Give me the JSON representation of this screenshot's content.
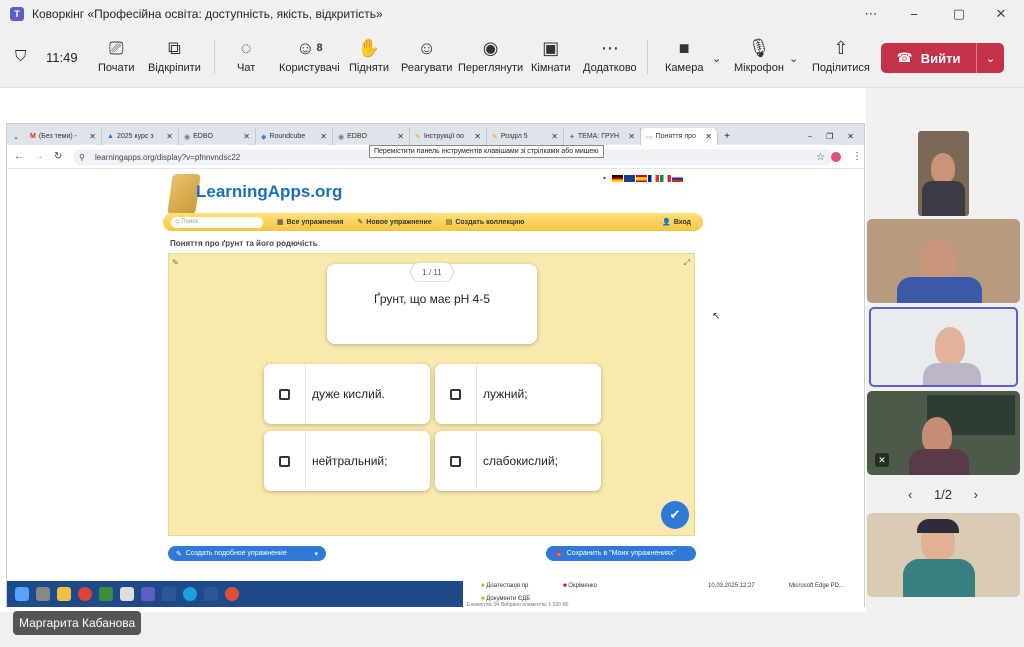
{
  "window": {
    "title": "Коворкінг «Професійна освіта: доступність, якість, відкритість»",
    "minimize": "⎯",
    "maximize": "▢",
    "close": "✕"
  },
  "toolbar": {
    "time": "11:49",
    "present": "Почати",
    "popout": "Відкріпити",
    "chat": "Чат",
    "people": "Користувачі",
    "people_count": "8",
    "raise": "Підняти",
    "react": "Реагувати",
    "view": "Переглянути",
    "rooms": "Кімнати",
    "more": "Додатково",
    "camera": "Камера",
    "mic": "Мікрофон",
    "share": "Поділитися",
    "leave": "Вийти"
  },
  "browser": {
    "tabs": [
      {
        "label": "(Без теми) -",
        "icon": "M",
        "color": "#d93025"
      },
      {
        "label": "2025 курс з",
        "icon": "▲",
        "color": "#1a73e8"
      },
      {
        "label": "EDBO",
        "icon": "◉",
        "color": "#777777"
      },
      {
        "label": "Roundcube",
        "icon": "◆",
        "color": "#3b7dd8"
      },
      {
        "label": "EDBO",
        "icon": "◉",
        "color": "#777777"
      },
      {
        "label": "Інструкції по",
        "icon": "✎",
        "color": "#e6a800"
      },
      {
        "label": "Розділ 5",
        "icon": "✎",
        "color": "#e6a800"
      },
      {
        "label": "ТЕМА: ГРУН",
        "icon": "✦",
        "color": "#8a6d3b"
      },
      {
        "label": "Поняття про",
        "icon": "▭",
        "color": "#e67e22"
      }
    ],
    "new_tab": "+",
    "url": "learningapps.org/display?v=pfnnvndsc22",
    "tooltip": "Перемістити панель інструментів клавішами зі стрілками або мишею"
  },
  "learningapps": {
    "logo": "LearningApps.org",
    "search_placeholder": "Поиск",
    "nav_all": "Все упражнения",
    "nav_new": "Новое упражнение",
    "nav_collection": "Создать коллекцию",
    "nav_login": "Вход",
    "exercise_title": "Поняття про ґрунт та його родючість",
    "counter": "1 / 11",
    "question": "Ґрунт, що має рН 4-5",
    "answers": [
      "дуже кислий.",
      "лужний;",
      "нейтральний;",
      "слабокислий;"
    ],
    "btn_create_similar": "Создать подобное упражнение",
    "btn_save": "Сохранить в \"Моих упражнениях\""
  },
  "explorer": {
    "folder1": "Доатестація пр",
    "folder2": "Документи ЄДБ",
    "file": "Окріменко",
    "date": "10.03.2025 12:27",
    "type": "Microsoft Edge PD...",
    "status": "Елементів: 94    Вибрано елементів: 1  520 КБ"
  },
  "participants": {
    "pager": "1/2",
    "speaker_name": "Маргарита Кабанова"
  },
  "colors": {
    "accent": "#5b5fc7",
    "leave": "#c4314b",
    "board": "#f9e9ad",
    "la_blue": "#2f7ad8"
  }
}
